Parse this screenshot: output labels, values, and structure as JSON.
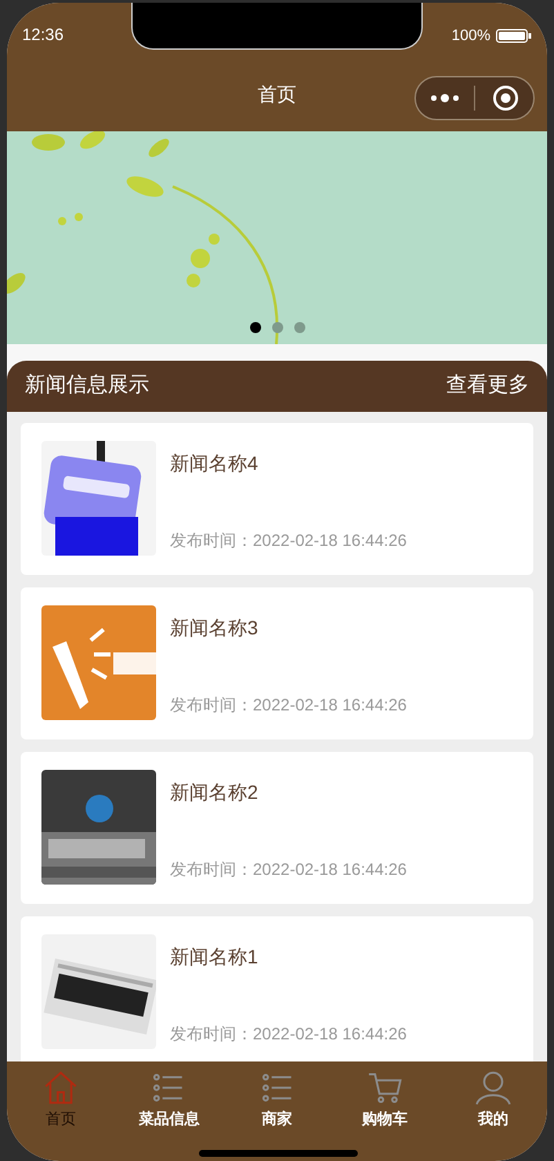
{
  "status_bar": {
    "time": "12:36",
    "battery": "100%"
  },
  "nav_bar": {
    "title": "首页"
  },
  "banner": {
    "dots": [
      {
        "selected": true
      },
      {
        "selected": false
      },
      {
        "selected": false
      }
    ]
  },
  "section": {
    "title": "新闻信息展示",
    "more_link": "查看更多"
  },
  "news": [
    {
      "title": "新闻名称4",
      "time": "发布时间：2022-02-18 16:44:26"
    },
    {
      "title": "新闻名称3",
      "time": "发布时间：2022-02-18 16:44:26"
    },
    {
      "title": "新闻名称2",
      "time": "发布时间：2022-02-18 16:44:26"
    },
    {
      "title": "新闻名称1",
      "time": "发布时间：2022-02-18 16:44:26"
    }
  ],
  "tab_bar": [
    {
      "label": "首页",
      "kind": "home",
      "selected": true
    },
    {
      "label": "菜品信息",
      "kind": "list",
      "selected": false
    },
    {
      "label": "商家",
      "kind": "list",
      "selected": false
    },
    {
      "label": "购物车",
      "kind": "cart",
      "selected": false
    },
    {
      "label": "我的",
      "kind": "user",
      "selected": false
    }
  ]
}
